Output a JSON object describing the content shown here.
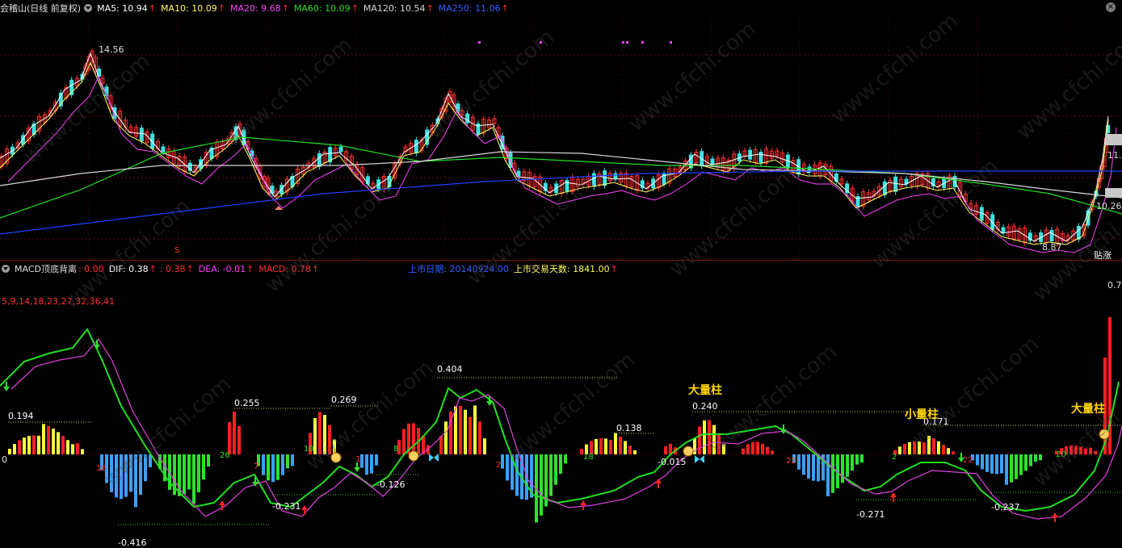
{
  "main_header": {
    "stock_name": "会稽山(日线 前复权)",
    "ma5": "MA5: 10.94",
    "ma10": "MA10: 10.09",
    "ma20": "MA20: 9.68",
    "ma60": "MA60: 10.09",
    "ma120": "MA120: 10.54",
    "ma250": "MA250: 11.06"
  },
  "main_labels": {
    "high": "14.56",
    "low": "8.87",
    "right_top": "11.",
    "right_bottom": "10.26",
    "right_bottom2": "贴涨",
    "mark_s": "S"
  },
  "macd_header": {
    "indicator": "MACD顶底背离",
    "value0": ": 0.00",
    "dif": "DIF: 0.38",
    "dif2": ": 0.38",
    "dea": "DEA: -0.01",
    "macd": "MACD: 0.78",
    "listing_date": "上市日期: 20140924.00",
    "trading_days": "上市交易天数: 1841.00"
  },
  "macd_labels": {
    "periods": "5,9,14,18,23,27,32,36,41",
    "right_top": "0.7",
    "zero": "0",
    "peaks": [
      "0.194",
      "0.255",
      "0.269",
      "0.404",
      "0.138",
      "0.240",
      "0.171"
    ],
    "troughs": [
      "-0.416",
      "-0.231",
      "-0.126",
      "-0.015",
      "-0.271",
      "-0.237"
    ],
    "counts": [
      "18",
      "26",
      "7",
      "10",
      "1",
      "8",
      "2",
      "18",
      "22",
      "2",
      "22",
      "1",
      "20"
    ],
    "big_bar": "大量柱",
    "small_bar": "小量柱"
  },
  "watermark": "www.cfchi.com",
  "colors": {
    "up": "#ff3030",
    "down": "#40e0e0",
    "ma5": "#ffffff",
    "ma10": "#ffff60",
    "ma20": "#ff40ff",
    "ma60": "#20e020",
    "ma120": "#d8d8d8",
    "ma250": "#2040ff"
  }
}
